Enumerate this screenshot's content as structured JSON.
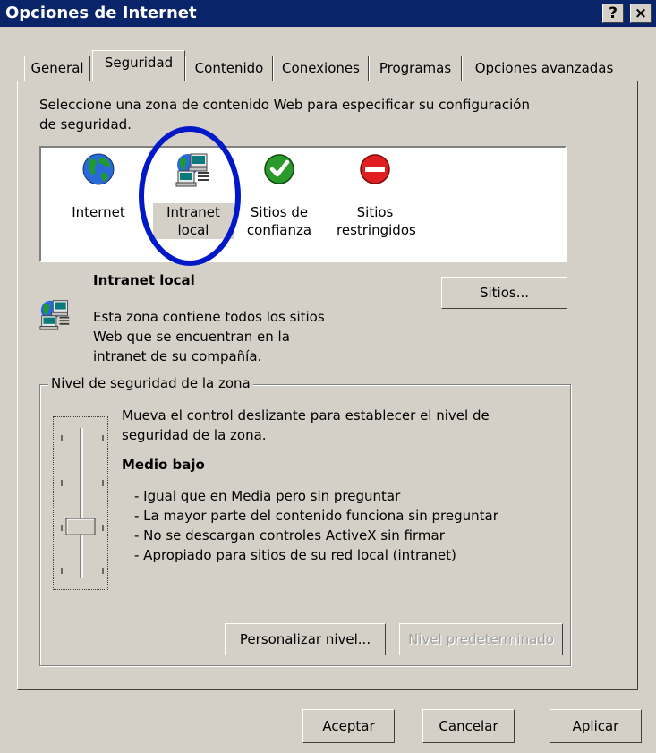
{
  "window": {
    "title": "Opciones de Internet",
    "help_glyph": "?",
    "close_glyph": "×"
  },
  "tabs": [
    {
      "label": "General"
    },
    {
      "label": "Seguridad"
    },
    {
      "label": "Contenido"
    },
    {
      "label": "Conexiones"
    },
    {
      "label": "Programas"
    },
    {
      "label": "Opciones avanzadas"
    }
  ],
  "security": {
    "instruction_line1": "Seleccione una zona de contenido Web para especificar su configuración",
    "instruction_line2": "de seguridad.",
    "zones": [
      {
        "line1": "Internet",
        "line2": "",
        "icon": "globe-icon"
      },
      {
        "line1": "Intranet",
        "line2": "local",
        "icon": "network-computer-icon"
      },
      {
        "line1": "Sitios de",
        "line2": "confianza",
        "icon": "checkmark-icon"
      },
      {
        "line1": "Sitios",
        "line2": "restringidos",
        "icon": "no-entry-icon"
      }
    ],
    "selected_zone_index": 1,
    "zone_name": "Intranet local",
    "zone_desc_line1": "Esta zona contiene todos los sitios",
    "zone_desc_line2": "Web que se encuentran en la",
    "zone_desc_line3": "intranet de su compañía.",
    "sites_button": "Sitios...",
    "level_group_title": "Nivel de seguridad de la zona",
    "level_desc_line1": "Mueva el control deslizante para establecer el nivel de",
    "level_desc_line2": "seguridad de la zona.",
    "level_name": "Medio bajo",
    "level_bullets": [
      "- Igual que en Media pero sin preguntar",
      "- La mayor parte del contenido funciona sin preguntar",
      "- No se descargan controles ActiveX sin firmar",
      "- Apropiado para sitios de su red local (intranet)"
    ],
    "slider_level_fraction": 0.33,
    "custom_level_button": "Personalizar nivel...",
    "default_level_button": "Nivel predeterminado"
  },
  "footer": {
    "ok": "Aceptar",
    "cancel": "Cancelar",
    "apply": "Aplicar"
  },
  "colors": {
    "titlebar": "#0a246a",
    "face": "#d4d0c8",
    "annotation_circle": "#0018c8"
  }
}
